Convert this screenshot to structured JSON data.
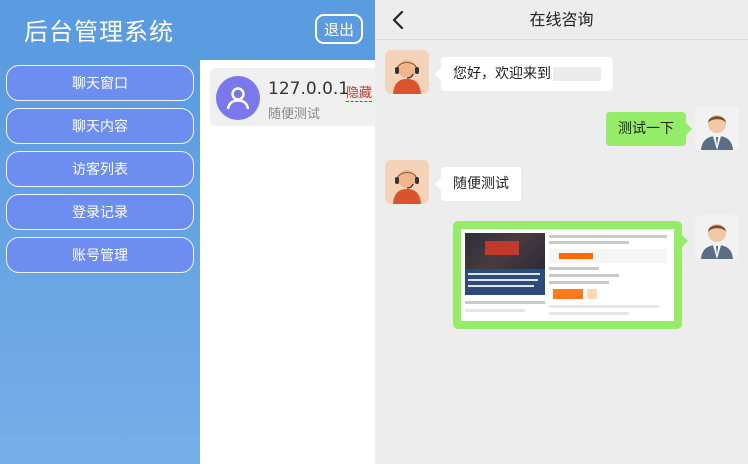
{
  "admin": {
    "title": "后台管理系统",
    "logout_label": "退出",
    "nav": [
      {
        "label": "聊天窗口"
      },
      {
        "label": "聊天内容"
      },
      {
        "label": "访客列表"
      },
      {
        "label": "登录记录"
      },
      {
        "label": "账号管理"
      }
    ],
    "sessions": [
      {
        "ip": "127.0.0.1",
        "tag": "隐藏",
        "last_message": "随便测试"
      }
    ]
  },
  "chat": {
    "title": "在线咨询",
    "messages": [
      {
        "side": "left",
        "text": "您好，欢迎来到"
      },
      {
        "side": "right",
        "text": "测试一下"
      },
      {
        "side": "left",
        "text": "随便测试"
      },
      {
        "side": "right",
        "type": "image"
      }
    ]
  },
  "colors": {
    "primary": "#5b9be0",
    "nav_button": "#6d8ef0",
    "bubble_green": "#95ec69",
    "chat_bg": "#ededed",
    "visitor_avatar": "#7b78ec"
  },
  "icons": {
    "back": "chevron-left-icon",
    "visitor": "user-icon"
  }
}
